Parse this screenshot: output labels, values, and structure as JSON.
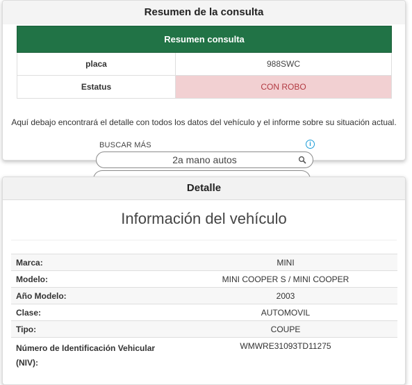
{
  "summary_card": {
    "title": "Resumen de la consulta",
    "table_header": "Resumen consulta",
    "rows": [
      {
        "label": "placa",
        "value": "988SWC"
      },
      {
        "label": "Estatus",
        "value": "CON ROBO"
      }
    ],
    "intro_text": "Aquí debajo encontrará el detalle con todos los datos del vehículo y el informe sobre su situación actual.",
    "ad": {
      "label": "BUSCAR MÁS",
      "search_text": "2a mano autos"
    }
  },
  "detail_card": {
    "title": "Detalle",
    "heading": "Información del vehículo",
    "rows": [
      {
        "label": "Marca:",
        "value": "MINI"
      },
      {
        "label": "Modelo:",
        "value": "MINI COOPER S / MINI COOPER"
      },
      {
        "label": "Año Modelo:",
        "value": "2003"
      },
      {
        "label": "Clase:",
        "value": "AUTOMOVIL"
      },
      {
        "label": "Tipo:",
        "value": "COUPE"
      },
      {
        "label": "Número de Identificación Vehicular (NIV):",
        "value": "WMWRE31093TD11275"
      }
    ]
  },
  "colors": {
    "header_green": "#217346",
    "alert_bg": "#f2d0d2",
    "alert_text": "#b23a42",
    "info_blue": "#1a9bd7"
  }
}
